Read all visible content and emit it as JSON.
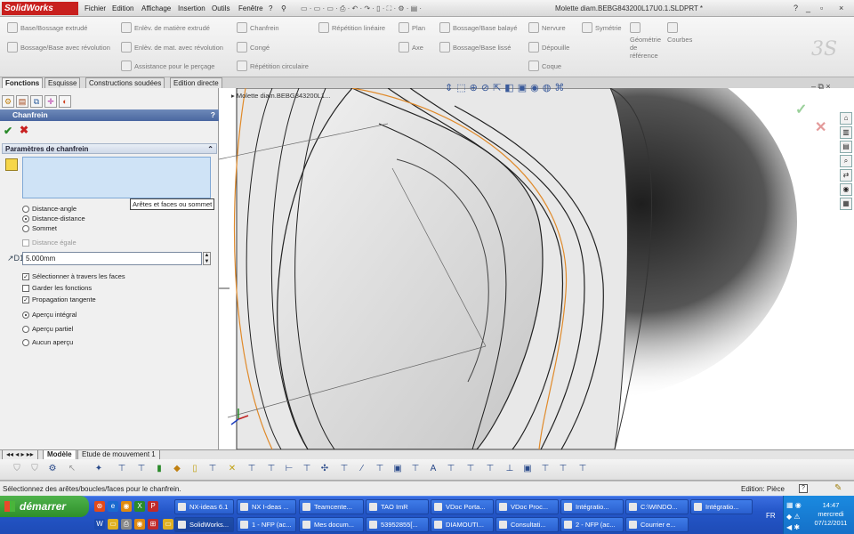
{
  "app": {
    "name": "SolidWorks",
    "doc_title": "Molette diam.BEBG843200L17U0.1.SLDPRT *"
  },
  "menu": [
    "Fichier",
    "Edition",
    "Affichage",
    "Insertion",
    "Outils",
    "Fenêtre"
  ],
  "window_buttons": [
    "?",
    "_",
    "▫",
    "×"
  ],
  "ribbon": {
    "col1": [
      "Base/Bossage extrudé",
      "Bossage/Base avec révolution"
    ],
    "col2": [
      "Enlèv. de matière extrudé",
      "Enlèv. de mat. avec révolution",
      "Assistance pour le perçage"
    ],
    "col3": [
      "Chanfrein",
      "Congé",
      "Répétition circulaire"
    ],
    "col4": [
      "Répétition linéaire"
    ],
    "col5": [
      "Plan",
      "Axe"
    ],
    "col6": [
      "Bossage/Base balayé",
      "Bossage/Base lissé"
    ],
    "col7": [
      "Nervure",
      "Dépouille",
      "Coque"
    ],
    "col8": [
      "Symétrie"
    ],
    "col9": [
      "Géométrie de référence"
    ],
    "col10": [
      "Courbes"
    ]
  },
  "tabs": [
    "Fonctions",
    "Esquisse",
    "Constructions soudées",
    "Edition directe"
  ],
  "feature": {
    "title": "Chanfrein",
    "help": "?",
    "group_title": "Paramètres de chanfrein",
    "tooltip": "Arêtes et faces ou sommet",
    "type_options": [
      {
        "label": "Distance-angle",
        "selected": false
      },
      {
        "label": "Distance-distance",
        "selected": true
      },
      {
        "label": "Sommet",
        "selected": false
      }
    ],
    "equal_distance": {
      "label": "Distance égale",
      "checked": false
    },
    "distance_value": "5.000mm",
    "checkboxes": [
      {
        "label": "Sélectionner à travers les faces",
        "checked": true
      },
      {
        "label": "Garder les fonctions",
        "checked": false
      },
      {
        "label": "Propagation tangente",
        "checked": true
      }
    ],
    "preview_options": [
      {
        "label": "Aperçu intégral",
        "selected": true
      },
      {
        "label": "Aperçu partiel",
        "selected": false
      },
      {
        "label": "Aucun aperçu",
        "selected": false
      }
    ]
  },
  "viewport": {
    "tree_label": "Molette diam.BEBG843200L1..."
  },
  "bottom_tabs": [
    "Modèle",
    "Etude de mouvement 1"
  ],
  "status": {
    "message": "Sélectionnez des arêtes/boucles/faces pour le chanfrein.",
    "edit_mode": "Edition: Pièce",
    "help": "?"
  },
  "taskbar": {
    "start_label": "démarrer",
    "row1": [
      "NX-ideas 6.1",
      "NX I-deas ...",
      "Teamcente...",
      "TAO ImR",
      "VDoc Porta...",
      "VDoc Proc...",
      "Intégratio...",
      "C:\\WINDO...",
      "Intégratio..."
    ],
    "row2": [
      "SolidWorks...",
      "1 - NFP (ac...",
      "Mes docum...",
      "53952855[...",
      "DIAMOUTI...",
      "Consultati...",
      "2 - NFP (ac...",
      "Courrier e..."
    ],
    "lang": "FR",
    "clock_time": "14:47",
    "clock_day": "mercredi",
    "clock_date": "07/12/2011"
  }
}
